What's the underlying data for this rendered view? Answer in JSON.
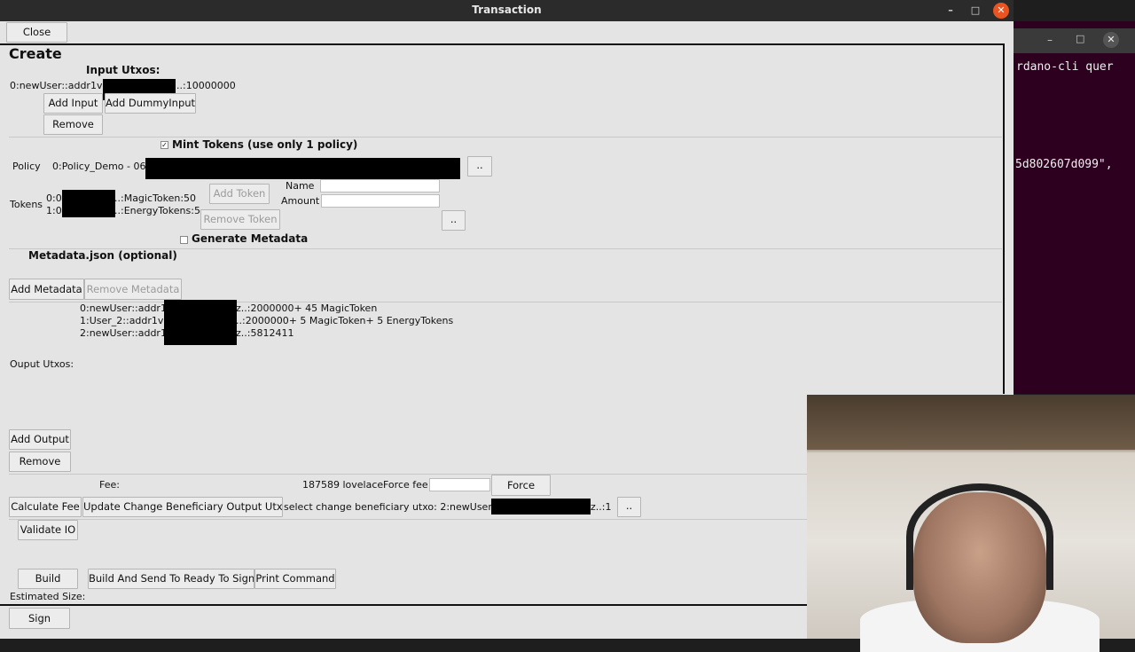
{
  "window": {
    "title": "Transaction",
    "close_label": "Close",
    "section_title": "Create"
  },
  "inputs": {
    "header": "Input Utxos:",
    "utxo_prefix": "0:newUser::addr1v",
    "utxo_suffix": "..:10000000",
    "add_input": "Add Input",
    "add_dummy_input": "Add DummyInput",
    "remove": "Remove"
  },
  "mint": {
    "checked": true,
    "checkbox_label": "Mint Tokens (use only 1 policy)",
    "policy_label": "Policy",
    "policy_value": "0:Policy_Demo - 06",
    "browse": "..",
    "tokens_label": "Tokens",
    "token_lines": [
      {
        "prefix": "0:0",
        "suffix": "..:MagicToken:50"
      },
      {
        "prefix": "1:0",
        "suffix": "..:EnergyTokens:5"
      }
    ],
    "add_token": "Add Token",
    "remove_token": "Remove Token",
    "name_label": "Name",
    "amount_label": "Amount",
    "name_value": "",
    "amount_value": "",
    "browse2": "..",
    "generate_metadata_checked": false,
    "generate_metadata_label": "Generate Metadata"
  },
  "metadata": {
    "header": "Metadata.json (optional)",
    "add": "Add Metadata",
    "remove": "Remove Metadata"
  },
  "outputs": {
    "header": "Ouput Utxos:",
    "lines": [
      {
        "prefix": "0:newUser::addr1v",
        "suffix": "z..:2000000+ 45 MagicToken"
      },
      {
        "prefix": "1:User_2::addr1v8",
        "suffix": "..:2000000+ 5 MagicToken+ 5 EnergyTokens"
      },
      {
        "prefix": "2:newUser::addr1v",
        "suffix": "z..:5812411"
      }
    ],
    "add_output": "Add Output",
    "remove": "Remove"
  },
  "fee": {
    "label": "Fee:",
    "value": "187589 lovelace",
    "force_fee_label": "Force fee",
    "force_fee_value": "",
    "force_button": "Force",
    "calculate": "Calculate Fee",
    "update_change": "Update Change Beneficiary Output Utxo",
    "select_change_prefix": "select change beneficiary utxo: 2:newUser:",
    "select_change_suffix": "z..:1",
    "browse": ".."
  },
  "actions": {
    "validate": "Validate IO",
    "build": "Build",
    "build_send": "Build And Send To Ready To Sign",
    "print_command": "Print Command",
    "estimated_size": "Estimated Size:",
    "sign": "Sign"
  },
  "terminal": {
    "line1": "rdano-cli quer",
    "line2": "5d802607d099\","
  },
  "colors": {
    "accent": "#e95420",
    "terminal_bg": "#2c001e",
    "panel_bg": "#e4e4e4"
  }
}
